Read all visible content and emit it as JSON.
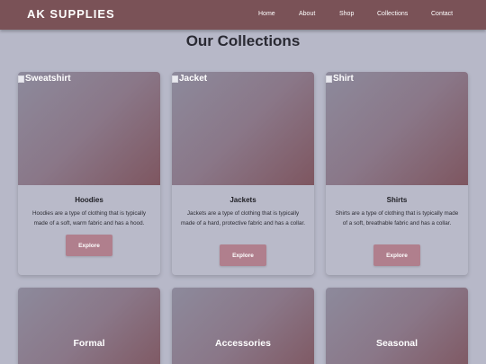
{
  "brand": "AK SUPPLIES",
  "nav": [
    "Home",
    "About",
    "Shop",
    "Collections",
    "Contact"
  ],
  "page_title": "Our Collections",
  "cards": [
    {
      "img_alt": "Sweatshirt",
      "title": "Hoodies",
      "description": "Hoodies are a type of clothing that is typically made of a soft, warm fabric and has a hood.",
      "button": "Explore"
    },
    {
      "img_alt": "Jacket",
      "title": "Jackets",
      "description": "Jackets are a type of clothing that is typically made of a hard, protective fabric and has a collar.",
      "button": "Explore"
    },
    {
      "img_alt": "Shirt",
      "title": "Shirts",
      "description": "Shirts are a type of clothing that is typically made of a soft, breathable fabric and has a collar.",
      "button": "Explore"
    }
  ],
  "bottom_cards": [
    "Formal",
    "Accessories",
    "Seasonal"
  ],
  "colors": {
    "navbar": "#7a5257",
    "background": "#b7b8c8",
    "button": "#b07f8d"
  }
}
